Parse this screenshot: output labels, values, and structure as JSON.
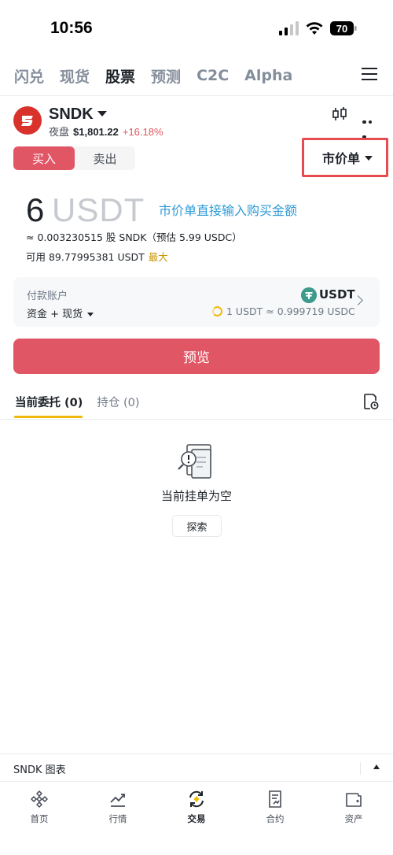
{
  "status_bar": {
    "time": "10:56",
    "battery": "70"
  },
  "top_tabs": [
    {
      "label": "闪兑",
      "active": false
    },
    {
      "label": "现货",
      "active": false
    },
    {
      "label": "股票",
      "active": true
    },
    {
      "label": "预测",
      "active": false
    },
    {
      "label": "C2C",
      "active": false
    },
    {
      "label": "Alpha",
      "active": false
    }
  ],
  "asset": {
    "symbol": "SNDK",
    "session": "夜盘",
    "price": "$1,801.22",
    "change": "+16.18%",
    "change_color": "#e0575f",
    "logo_color": "#d9322d"
  },
  "trade_side": {
    "buy_label": "买入",
    "sell_label": "卖出",
    "selected": "buy",
    "buy_color": "#e05665"
  },
  "order_type": {
    "label": "市价单",
    "highlight_color": "#e84b4f"
  },
  "amount": {
    "value": "6",
    "unit": "USDT",
    "hint": "市价单直接输入购买金额",
    "estimate": "≈ 0.003230515 股 SNDK（预估 5.99 USDC）",
    "available_label": "可用 89.77995381 USDT",
    "max_label": "最大"
  },
  "payment": {
    "title": "付款账户",
    "account": "资金 + 现货",
    "token": "USDT",
    "token_color": "#3c9b8d",
    "rate": "1 USDT ≈ 0.999719 USDC"
  },
  "preview_button": {
    "label": "预览"
  },
  "order_tabs": [
    {
      "label": "当前委托 (0)",
      "active": true
    },
    {
      "label": "持仓 (0)",
      "active": false
    }
  ],
  "empty_state": {
    "title": "当前挂单为空",
    "button": "探索"
  },
  "chart_bar": {
    "label": "SNDK 图表"
  },
  "bottom_nav": [
    {
      "label": "首页",
      "icon": "home-icon",
      "active": false
    },
    {
      "label": "行情",
      "icon": "markets-icon",
      "active": false
    },
    {
      "label": "交易",
      "icon": "trade-icon",
      "active": true
    },
    {
      "label": "合约",
      "icon": "futures-icon",
      "active": false
    },
    {
      "label": "资产",
      "icon": "wallet-icon",
      "active": false
    }
  ],
  "colors": {
    "accent_yellow": "#f0b90b",
    "sell_red": "#e05665",
    "link_blue": "#2f9bd6"
  }
}
